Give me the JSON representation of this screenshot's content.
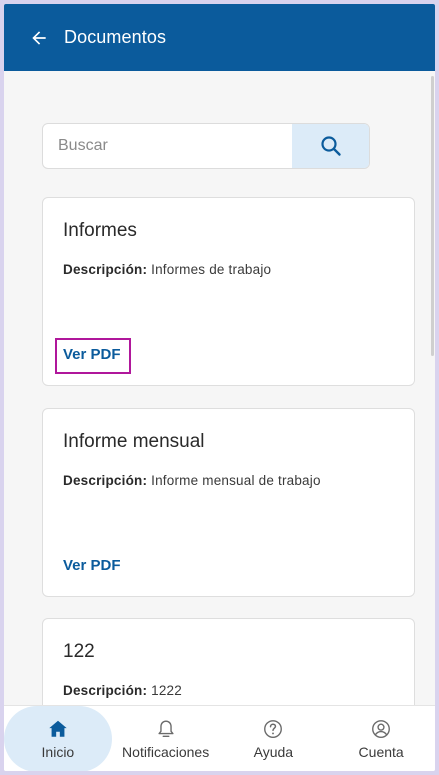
{
  "header": {
    "title": "Documentos"
  },
  "search": {
    "placeholder": "Buscar"
  },
  "documents": [
    {
      "title": "Informes",
      "desc_label": "Descripción:",
      "desc": "Informes de trabajo",
      "link": "Ver PDF"
    },
    {
      "title": "Informe mensual",
      "desc_label": "Descripción:",
      "desc": "Informe mensual de trabajo",
      "link": "Ver PDF"
    },
    {
      "title": "122",
      "desc_label": "Descripción:",
      "desc": "1222"
    }
  ],
  "bottom_nav": [
    {
      "label": "Inicio",
      "icon": "home-icon",
      "active": true
    },
    {
      "label": "Notificaciones",
      "icon": "bell-icon"
    },
    {
      "label": "Ayuda",
      "icon": "help-icon"
    },
    {
      "label": "Cuenta",
      "icon": "account-icon"
    }
  ],
  "colors": {
    "primary": "#0b5b9c",
    "active_bg": "#dcebf8",
    "highlight": "#b0179b"
  }
}
